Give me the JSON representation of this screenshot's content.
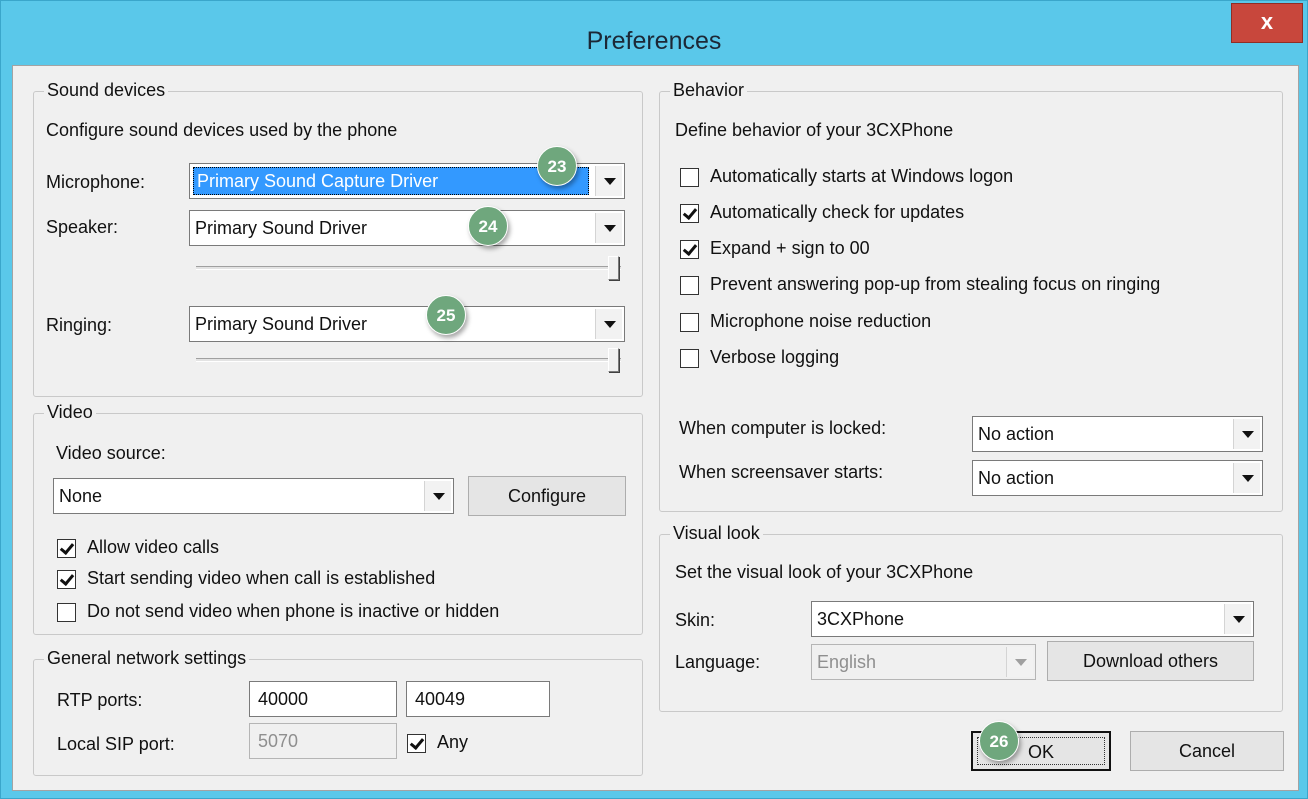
{
  "window": {
    "title": "Preferences",
    "close_label": "x"
  },
  "sound": {
    "legend": "Sound devices",
    "description": "Configure sound devices used by the phone",
    "microphone_label": "Microphone:",
    "microphone_value": "Primary Sound Capture Driver",
    "speaker_label": "Speaker:",
    "speaker_value": "Primary Sound Driver",
    "speaker_volume": 1.0,
    "ringing_label": "Ringing:",
    "ringing_value": "Primary Sound Driver",
    "ringing_volume": 1.0
  },
  "video": {
    "legend": "Video",
    "source_label": "Video source:",
    "source_value": "None",
    "configure_label": "Configure",
    "options": [
      {
        "label": "Allow video calls",
        "checked": true
      },
      {
        "label": "Start sending video when call is established",
        "checked": true
      },
      {
        "label": "Do not send video when phone is inactive or hidden",
        "checked": false
      }
    ]
  },
  "network": {
    "legend": "General network settings",
    "rtp_label": "RTP ports:",
    "rtp_start": "40000",
    "rtp_end": "40049",
    "sip_label": "Local SIP port:",
    "sip_value": "5070",
    "any_label": "Any",
    "any_checked": true
  },
  "behavior": {
    "legend": "Behavior",
    "description": "Define behavior of your 3CXPhone",
    "options": [
      {
        "label": "Automatically starts at Windows logon",
        "checked": false
      },
      {
        "label": "Automatically check for updates",
        "checked": true
      },
      {
        "label": "Expand + sign to 00",
        "checked": true
      },
      {
        "label": "Prevent answering pop-up from stealing focus on ringing",
        "checked": false
      },
      {
        "label": "Microphone noise reduction",
        "checked": false
      },
      {
        "label": "Verbose logging",
        "checked": false
      }
    ],
    "locked_label": "When computer is locked:",
    "locked_value": "No action",
    "screensaver_label": "When screensaver starts:",
    "screensaver_value": "No action"
  },
  "visual": {
    "legend": "Visual look",
    "description": "Set the visual look of your 3CXPhone",
    "skin_label": "Skin:",
    "skin_value": "3CXPhone",
    "language_label": "Language:",
    "language_value": "English",
    "download_label": "Download others"
  },
  "buttons": {
    "ok_label": "OK",
    "cancel_label": "Cancel"
  },
  "callouts": {
    "c23": "23",
    "c24": "24",
    "c25": "25",
    "c26": "26"
  },
  "colors": {
    "title_bar": "#5ac8ea",
    "close_button": "#c8473c",
    "selection": "#3399ff",
    "callout": "#6fa77d"
  }
}
